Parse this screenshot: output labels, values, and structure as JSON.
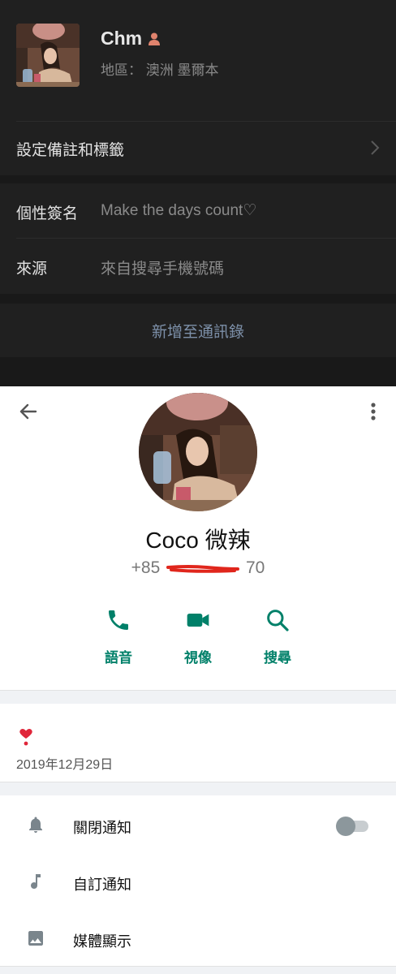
{
  "wechat_profile": {
    "name": "Chm",
    "region": "地區：  澳洲  墨爾本",
    "remark_label": "設定備註和標籤",
    "signature_key": "個性簽名",
    "signature_value": "Make the days count♡",
    "source_key": "來源",
    "source_value": "來自搜尋手機號碼",
    "add_button": "新增至通訊錄"
  },
  "contact": {
    "name": "Coco 微辣",
    "phone_prefix": "+85",
    "phone_suffix": "70",
    "actions": [
      {
        "label": "語音",
        "icon": "phone-icon"
      },
      {
        "label": "視像",
        "icon": "video-icon"
      },
      {
        "label": "搜尋",
        "icon": "search-icon"
      }
    ],
    "about_emoji": "heart-exclamation-icon",
    "about_date": "2019年12月29日",
    "settings": [
      {
        "label": "關閉通知",
        "icon": "bell-icon"
      },
      {
        "label": "自訂通知",
        "icon": "music-note-icon"
      },
      {
        "label": "媒體顯示",
        "icon": "image-icon"
      }
    ]
  },
  "colors": {
    "accent_green": "#008069",
    "dark_bg": "#191919",
    "dark_card": "#202020",
    "link_blue_gray": "#7d90a9",
    "redaction_red": "#e0261c"
  }
}
